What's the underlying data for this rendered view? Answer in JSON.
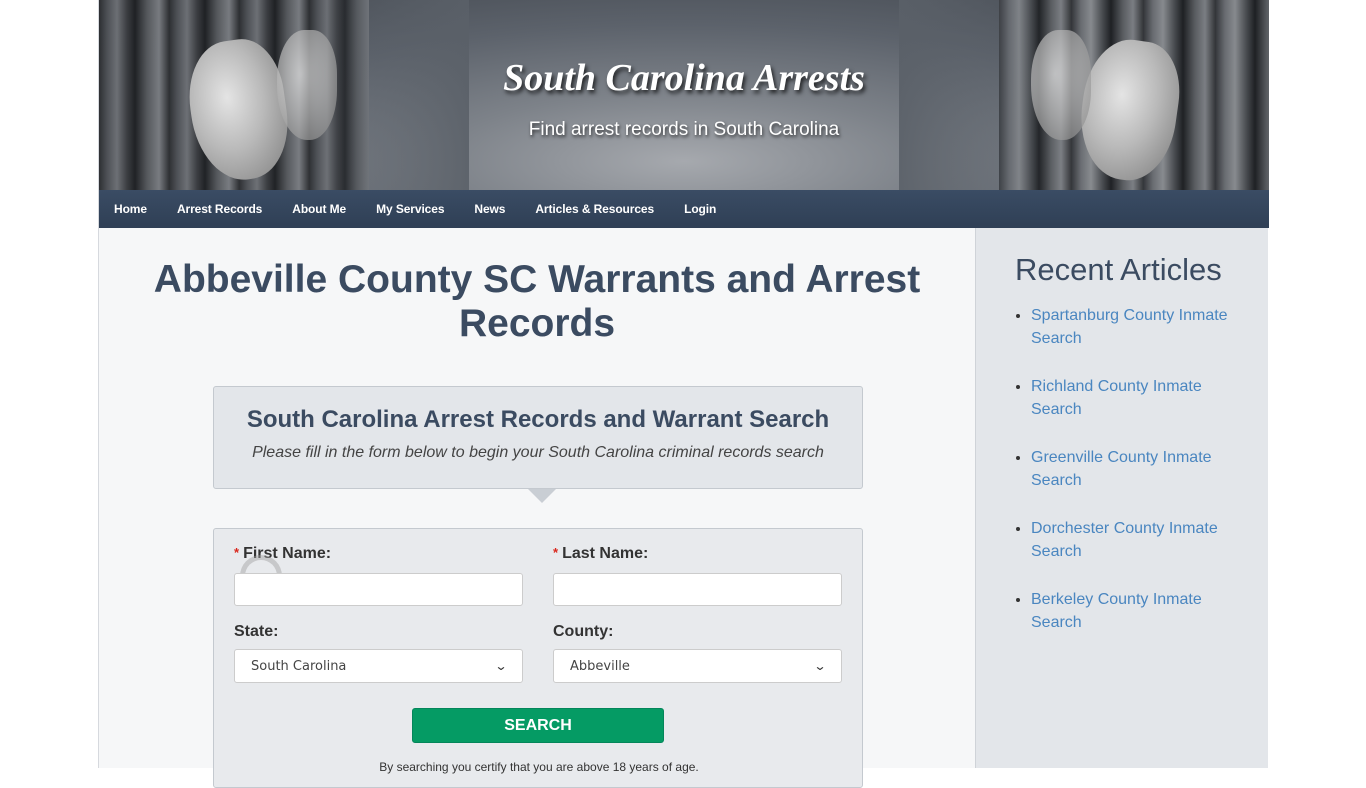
{
  "header": {
    "site_title": "South Carolina Arrests",
    "tagline": "Find arrest records in South Carolina"
  },
  "nav": {
    "items": [
      {
        "label": "Home"
      },
      {
        "label": "Arrest Records"
      },
      {
        "label": "About Me"
      },
      {
        "label": "My Services"
      },
      {
        "label": "News"
      },
      {
        "label": "Articles & Resources"
      },
      {
        "label": "Login"
      }
    ]
  },
  "main": {
    "page_title": "Abbeville County SC Warrants and Arrest Records",
    "info_box": {
      "title": "South Carolina Arrest Records and Warrant Search",
      "subtitle": "Please fill in the form below to begin your South Carolina criminal records search"
    },
    "form": {
      "required_mark": "*",
      "first_name_label": "First Name:",
      "first_name_value": "",
      "last_name_label": "Last Name:",
      "last_name_value": "",
      "state_label": "State:",
      "state_selected": "South Carolina",
      "county_label": "County:",
      "county_selected": "Abbeville",
      "search_label": "SEARCH",
      "certify_text": "By searching you certify that you are above 18 years of age."
    }
  },
  "sidebar": {
    "title": "Recent Articles",
    "articles": [
      {
        "label": "Spartanburg County Inmate Search"
      },
      {
        "label": "Richland County Inmate Search"
      },
      {
        "label": "Greenville County Inmate Search"
      },
      {
        "label": "Dorchester County Inmate Search"
      },
      {
        "label": "Berkeley County Inmate Search"
      }
    ]
  },
  "colors": {
    "nav_bg": "#34465d",
    "heading": "#3b4b61",
    "link": "#4a86c0",
    "search_button": "#059b64",
    "required": "#d9261c"
  }
}
